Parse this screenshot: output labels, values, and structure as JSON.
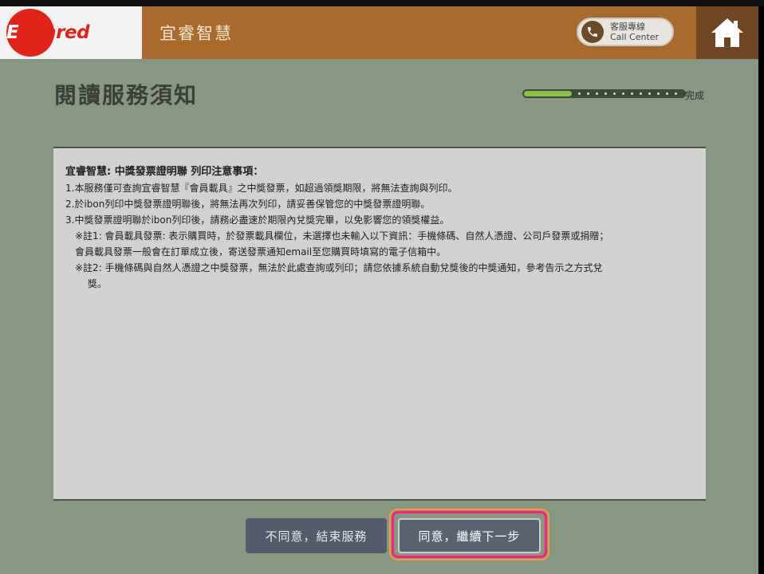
{
  "header": {
    "logo_lead": "E",
    "logo_rest": "denred",
    "brand_title": "宜睿智慧",
    "call_center_line1": "客服專線",
    "call_center_line2": "Call Center",
    "icons": {
      "phone": "phone-icon",
      "home": "home-icon"
    }
  },
  "page": {
    "title": "閱讀服務須知",
    "progress_label": "完成",
    "progress_fraction": 0.3
  },
  "notice": {
    "heading": "宜睿智慧: 中獎發票證明聯 列印注意事項：",
    "items": [
      "1.本服務僅可查詢宜睿智慧『會員載具』之中獎發票，如超過領獎期限，將無法查詢與列印。",
      "2.於ibon列印中獎發票證明聯後，將無法再次列印，請妥善保管您的中獎發票證明聯。",
      "3.中獎發票證明聯於ibon列印後，請務必盡速於期限內兌獎完畢，以免影響您的領獎權益。"
    ],
    "note1_a": "※註1: 會員載具發票: 表示購買時，於發票載具欄位，未選擇也未輸入以下資訊：手機條碼、自然人憑證、公司戶發票或捐贈；",
    "note1_b": "會員載具發票一般會在訂單成立後，寄送發票通知email至您購買時填寫的電子信箱中。",
    "note2_a": "※註2:  手機條碼與自然人憑證之中獎發票，無法於此處查詢或列印；請您依據系統自動兌獎後的中獎通知，參考告示之方式兌",
    "note2_b": "獎。"
  },
  "buttons": {
    "disagree": "不同意，結束服務",
    "agree": "同意，繼續下一步"
  },
  "colors": {
    "brand_bar": "#a96a2e",
    "page_bg": "#879781",
    "progress_fill": "#8cc04a",
    "highlight": "#ff1f80"
  }
}
